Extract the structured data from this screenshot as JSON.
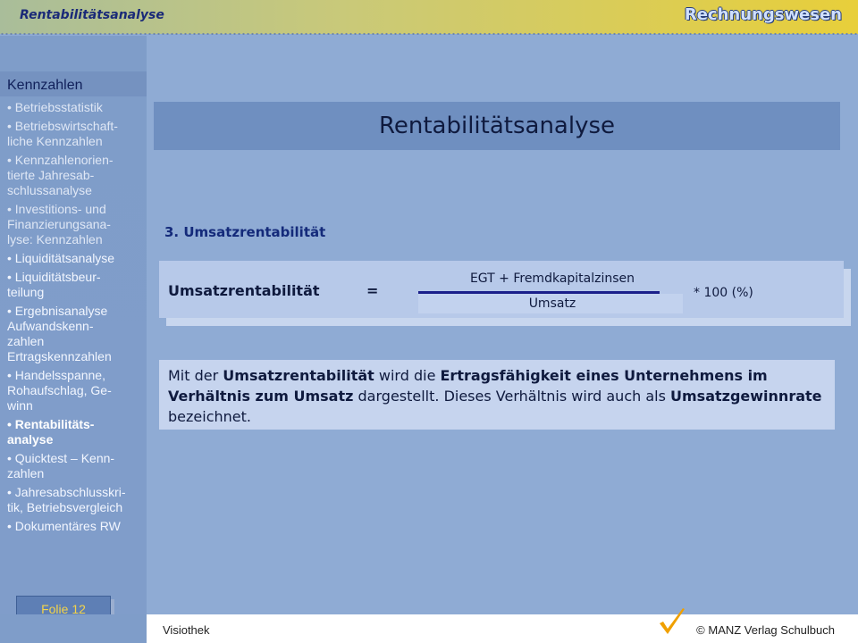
{
  "header": {
    "breadcrumb": "Rentabilitätsanalyse",
    "brand": "Rechnungswesen"
  },
  "sidebar": {
    "title": "Kennzahlen",
    "items": [
      {
        "label": "• Betriebsstatistik",
        "state": "dim"
      },
      {
        "label": "• Betriebswirtschaft-\n  liche Kennzahlen",
        "state": "dim"
      },
      {
        "label": "• Kennzahlenorien-\n  tierte Jahresab-\n  schlussanalyse",
        "state": "dim"
      },
      {
        "label": "• Investitions- und\n  Finanzierungsana-\n  lyse: Kennzahlen",
        "state": "dim"
      },
      {
        "label": "• Liquiditätsanalyse",
        "state": "normal"
      },
      {
        "label": "• Liquiditätsbeur-\n  teilung",
        "state": "normal"
      },
      {
        "label": "• Ergebnisanalyse\n    Aufwandskenn-\n    zahlen\n    Ertragskennzahlen",
        "state": "normal"
      },
      {
        "label": "• Handelsspanne,\n  Rohaufschlag, Ge-\n  winn",
        "state": "normal"
      },
      {
        "label": "• Rentabilitäts-\n  analyse",
        "state": "active"
      },
      {
        "label": "• Quicktest – Kenn-\n  zahlen",
        "state": "normal"
      },
      {
        "label": "• Jahresabschlusskri-\n  tik, Betriebsvergleich",
        "state": "normal"
      },
      {
        "label": "• Dokumentäres RW",
        "state": "normal"
      }
    ],
    "slide_label": "Folie 12"
  },
  "main": {
    "title": "Rentabilitätsanalyse",
    "section_heading": "3. Umsatzrentabilität",
    "formula": {
      "label": "Umsatzrentabilität",
      "equals": "=",
      "numerator": "EGT + Fremdkapitalzinsen",
      "denominator": "Umsatz",
      "multiplier": "* 100 (%)"
    },
    "description": {
      "p1": "Mit der ",
      "b1": "Umsatzrentabilität",
      "p2": " wird die ",
      "b2": "Ertragsfähigkeit eines Unternehmens im Verhältnis zum Umsatz",
      "p3": " dargestellt. Dieses Verhältnis wird auch als ",
      "b3": "Umsatzgewinnrate",
      "p4": " bezeichnet."
    }
  },
  "footer": {
    "left": "Visiothek",
    "right": "© MANZ Verlag Schulbuch",
    "check_icon": "checkmark-icon",
    "check_color": "#f0a000"
  }
}
